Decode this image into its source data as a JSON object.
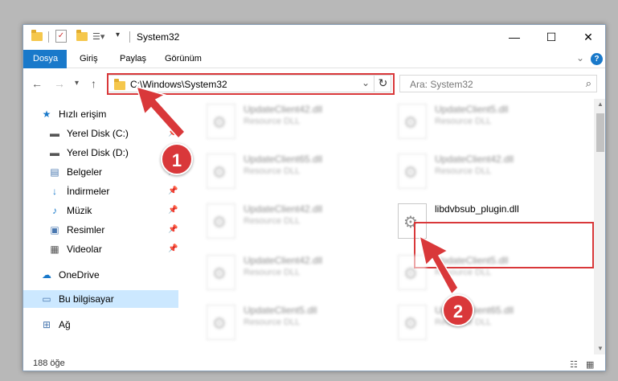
{
  "window": {
    "title": "System32",
    "controls": {
      "minimize": "—",
      "maximize": "☐",
      "close": "✕"
    }
  },
  "ribbon": {
    "tabs": [
      "Dosya",
      "Giriş",
      "Paylaş",
      "Görünüm"
    ],
    "help_icon": "?",
    "collapse_icon": "⌄"
  },
  "address": {
    "path": "C:\\Windows\\System32",
    "search_placeholder": "Ara: System32"
  },
  "sidebar": {
    "items": [
      {
        "label": "Hızlı erişim",
        "icon": "star-icon"
      },
      {
        "label": "Yerel Disk (C:)",
        "icon": "drive-icon",
        "pinned": true
      },
      {
        "label": "Yerel Disk (D:)",
        "icon": "drive-icon"
      },
      {
        "label": "Belgeler",
        "icon": "documents-icon",
        "pinned": true
      },
      {
        "label": "İndirmeler",
        "icon": "download-icon",
        "pinned": true
      },
      {
        "label": "Müzik",
        "icon": "music-icon",
        "pinned": true
      },
      {
        "label": "Resimler",
        "icon": "pictures-icon",
        "pinned": true
      },
      {
        "label": "Videolar",
        "icon": "videos-icon",
        "pinned": true
      },
      {
        "label": "OneDrive",
        "icon": "cloud-icon"
      },
      {
        "label": "Bu bilgisayar",
        "icon": "computer-icon",
        "selected": true
      },
      {
        "label": "Ağ",
        "icon": "network-icon"
      }
    ]
  },
  "files": [
    {
      "name": "UpdateClient42.dll",
      "type": "Resource DLL"
    },
    {
      "name": "UpdateClient5.dll",
      "type": "Resource DLL"
    },
    {
      "name": "UpdateClient65.dll",
      "type": "Resource DLL"
    },
    {
      "name": "UpdateClient42.dll",
      "type": "Resource DLL"
    },
    {
      "name": "UpdateClient42.dll",
      "type": "Resource DLL"
    },
    {
      "name": "libdvbsub_plugin.dll",
      "type": ""
    },
    {
      "name": "UpdateClient42.dll",
      "type": "Resource DLL"
    },
    {
      "name": "UpdateClient5.dll",
      "type": "Resource DLL"
    },
    {
      "name": "UpdateClient5.dll",
      "type": "Resource DLL"
    },
    {
      "name": "UpdateClient65.dll",
      "type": "Resource DLL"
    }
  ],
  "status": {
    "item_count": "188 öğe"
  },
  "annotations": {
    "step1": "1",
    "step2": "2",
    "color": "#d9383a"
  }
}
